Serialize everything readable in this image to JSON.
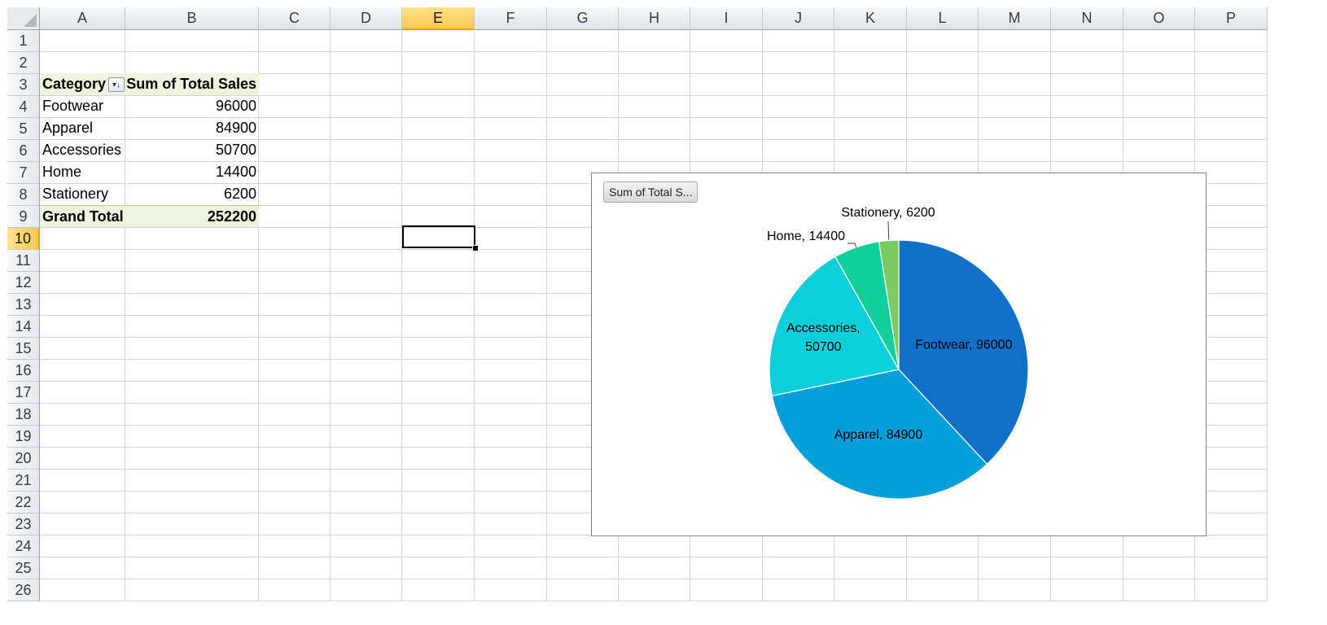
{
  "spreadsheet": {
    "columns": [
      "A",
      "B",
      "C",
      "D",
      "E",
      "F",
      "G",
      "H",
      "I",
      "J",
      "K",
      "L",
      "M",
      "N",
      "O",
      "P"
    ],
    "active_column": "E",
    "rows": [
      "1",
      "2",
      "3",
      "4",
      "5",
      "6",
      "7",
      "8",
      "9",
      "10",
      "11",
      "12",
      "13",
      "14",
      "15",
      "16",
      "17",
      "18",
      "19",
      "20",
      "21",
      "22",
      "23",
      "24",
      "25",
      "26"
    ],
    "active_row": "10"
  },
  "pivot_table": {
    "header_category": "Category",
    "header_value": "Sum of Total Sales",
    "rows": [
      {
        "label": "Footwear",
        "value": "96000"
      },
      {
        "label": "Apparel",
        "value": "84900"
      },
      {
        "label": "Accessories",
        "value": "50700"
      },
      {
        "label": "Home",
        "value": "14400"
      },
      {
        "label": "Stationery",
        "value": "6200"
      }
    ],
    "total_label": "Grand Total",
    "total_value": "252200",
    "filter_icon": "sort-filter-icon"
  },
  "chart": {
    "field_button_label": "Sum of Total S...",
    "colors": [
      "#1170c8",
      "#009fd9",
      "#0bd0d9",
      "#10cf9b",
      "#7cca62"
    ]
  },
  "chart_data": {
    "type": "pie",
    "categories": [
      "Footwear",
      "Apparel",
      "Accessories",
      "Home",
      "Stationery"
    ],
    "values": [
      96000,
      84900,
      50700,
      14400,
      6200
    ],
    "data_labels": [
      "Footwear, 96000",
      "Apparel, 84900",
      "Accessories, 50700",
      "Home, 14400",
      "Stationery, 6200"
    ],
    "title": "",
    "legend": "none"
  }
}
